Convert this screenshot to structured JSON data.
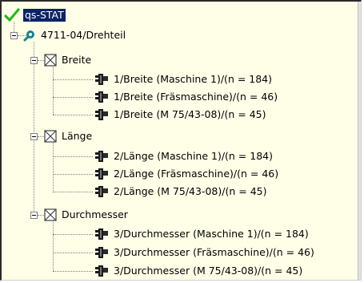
{
  "tree": {
    "root": {
      "label": "qs-STAT",
      "icon": "green-checkmark-icon"
    },
    "part": {
      "label": "4711-04/Drehteil",
      "icon": "part-icon"
    },
    "characteristics": [
      {
        "label": "Breite",
        "icon": "characteristic-box-icon",
        "items": [
          {
            "label": "1/Breite (Maschine 1)/(n = 184)",
            "icon": "gauge-icon"
          },
          {
            "label": "1/Breite (Fräsmaschine)/(n = 46)",
            "icon": "gauge-icon"
          },
          {
            "label": "1/Breite (M 75/43-08)/(n = 45)",
            "icon": "gauge-icon"
          }
        ]
      },
      {
        "label": "Länge",
        "icon": "characteristic-box-icon",
        "items": [
          {
            "label": "2/Länge (Maschine 1)/(n = 184)",
            "icon": "gauge-icon"
          },
          {
            "label": "2/Länge (Fräsmaschine)/(n = 46)",
            "icon": "gauge-icon"
          },
          {
            "label": "2/Länge (M 75/43-08)/(n = 45)",
            "icon": "gauge-icon"
          }
        ]
      },
      {
        "label": "Durchmesser",
        "icon": "characteristic-box-icon",
        "items": [
          {
            "label": "3/Durchmesser (Maschine 1)/(n = 184)",
            "icon": "gauge-icon"
          },
          {
            "label": "3/Durchmesser (Fräsmaschine)/(n = 46)",
            "icon": "gauge-icon"
          },
          {
            "label": "3/Durchmesser (M 75/43-08)/(n = 45)",
            "icon": "gauge-icon"
          }
        ]
      }
    ]
  },
  "colors": {
    "panel_background": "#ffffe8",
    "selection": "#0a2465",
    "checkmark": "#2fb51b",
    "part_icon": "#1f7f8c"
  }
}
